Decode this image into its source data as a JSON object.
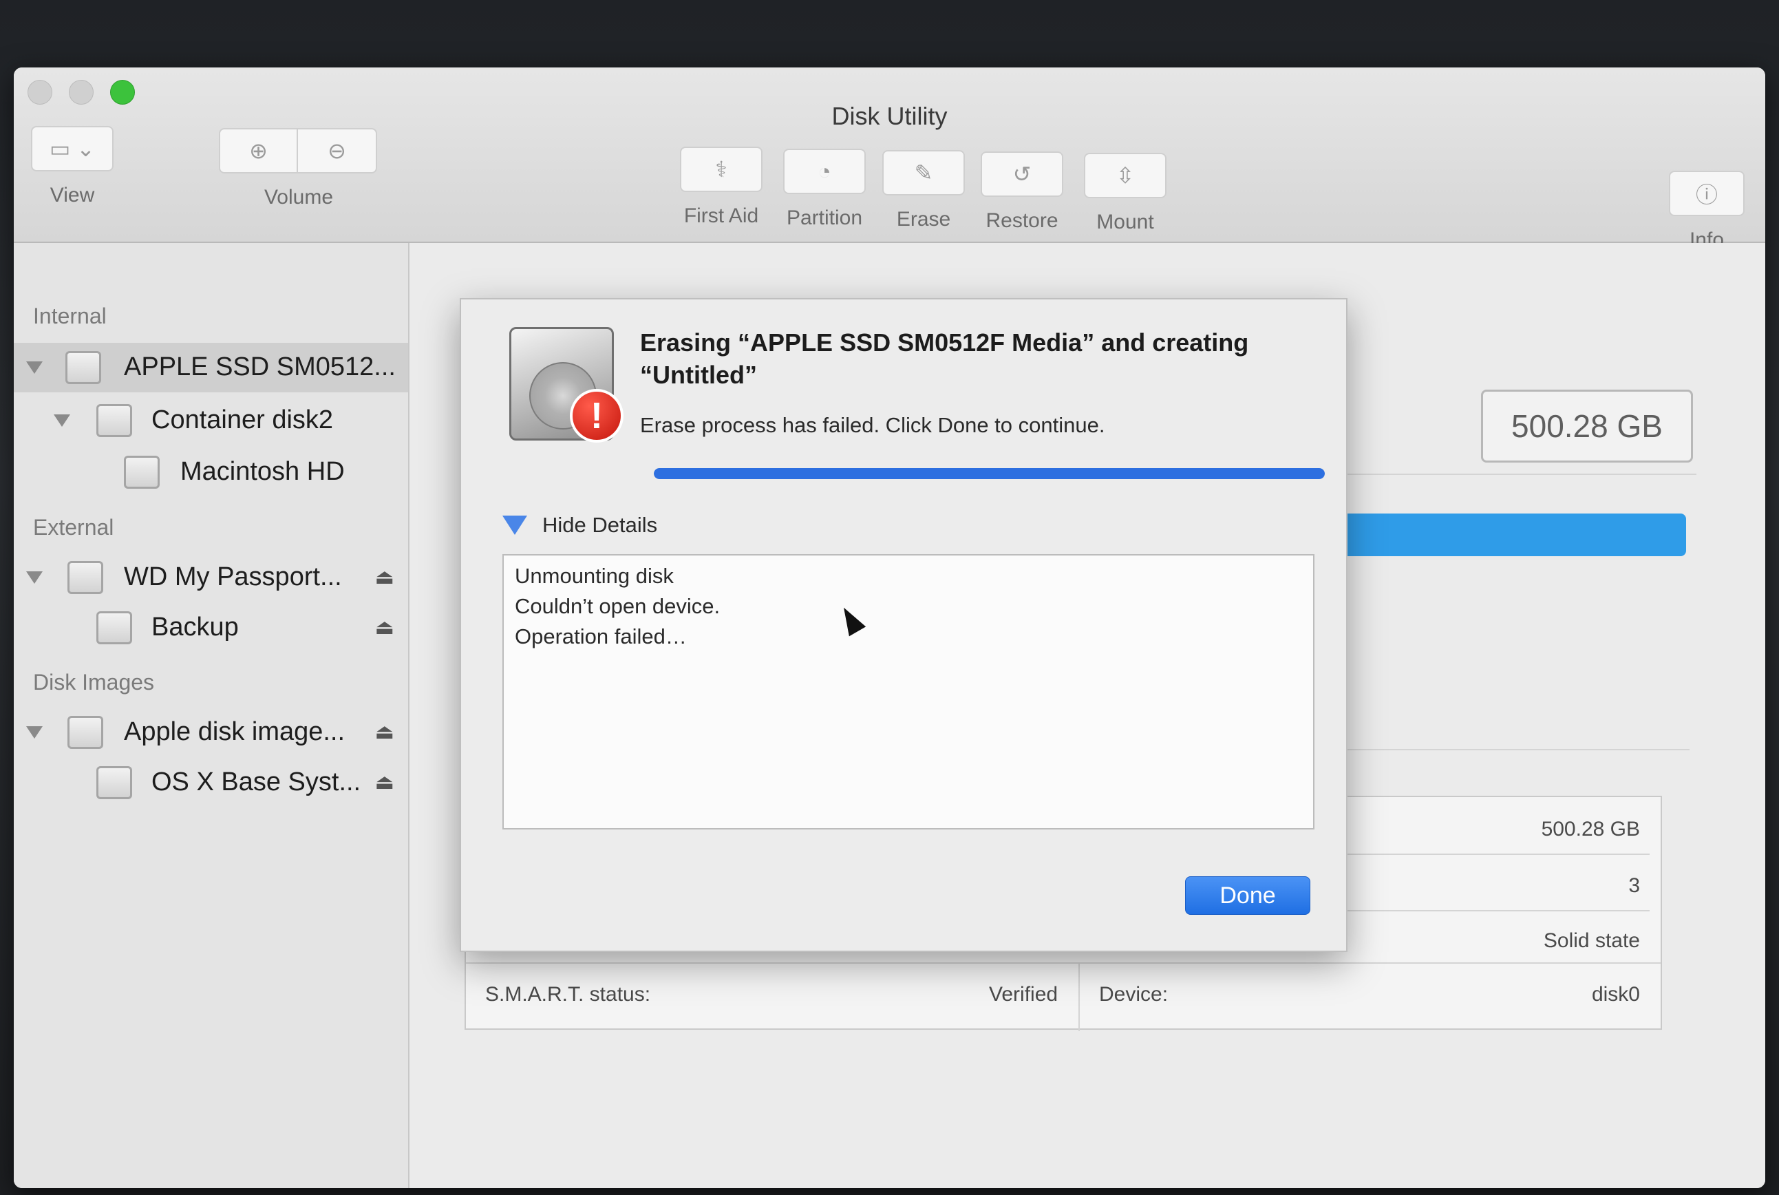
{
  "window": {
    "title": "Disk Utility"
  },
  "toolbar": {
    "view_label": "View",
    "volume_label": "Volume",
    "first_aid_label": "First Aid",
    "partition_label": "Partition",
    "erase_label": "Erase",
    "restore_label": "Restore",
    "mount_label": "Mount",
    "info_label": "Info"
  },
  "sidebar": {
    "internal_header": "Internal",
    "external_header": "External",
    "disk_images_header": "Disk Images",
    "items": [
      {
        "label": "APPLE SSD SM0512..."
      },
      {
        "label": "Container disk2"
      },
      {
        "label": "Macintosh HD"
      },
      {
        "label": "WD My Passport..."
      },
      {
        "label": "Backup"
      },
      {
        "label": "Apple disk image..."
      },
      {
        "label": "OS X Base Syst..."
      }
    ],
    "eject_glyph": "⏏"
  },
  "main": {
    "capacity": "500.28 GB",
    "table": {
      "capacity_value": "500.28 GB",
      "child_count_value": "3",
      "type_value": "Solid state",
      "smart_label": "S.M.A.R.T. status:",
      "smart_value": "Verified",
      "device_label": "Device:",
      "device_value": "disk0"
    }
  },
  "dialog": {
    "title": "Erasing “APPLE SSD SM0512F Media” and creating “Untitled”",
    "message": "Erase process has failed. Click Done to continue.",
    "progress": 1.0,
    "details_toggle": "Hide Details",
    "log": [
      "Unmounting disk",
      "Couldn’t open device.",
      "Operation failed…"
    ],
    "done_label": "Done"
  },
  "colors": {
    "accent": "#2d6fe0",
    "usage_bar": "#2f9ce8",
    "alert_red": "#d11e12",
    "maximize_green": "#3cc23c"
  }
}
